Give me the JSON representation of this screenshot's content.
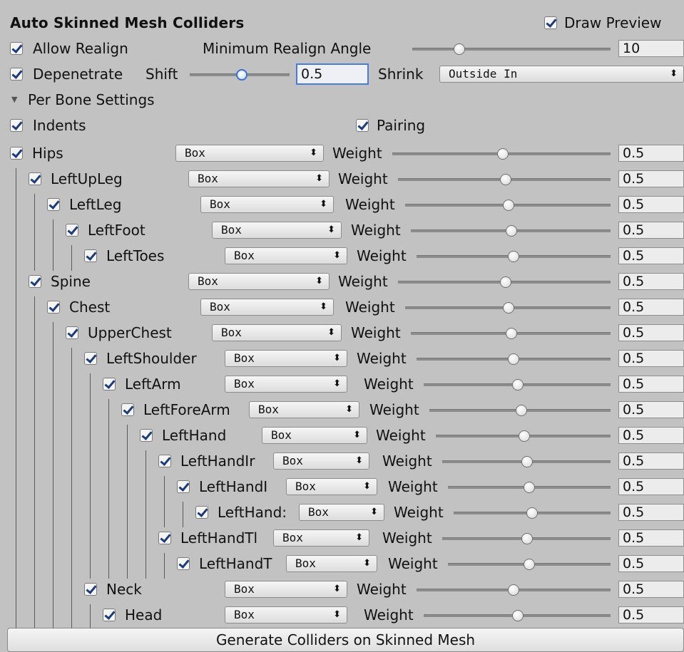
{
  "header": {
    "title": "Auto Skinned Mesh Colliders",
    "draw_preview_label": "Draw Preview",
    "draw_preview_checked": true
  },
  "realign": {
    "allow_label": "Allow Realign",
    "allow_checked": true,
    "min_angle_label": "Minimum Realign Angle",
    "min_angle_value": "10"
  },
  "depenetrate": {
    "label": "Depenetrate",
    "checked": true,
    "shift_label": "Shift",
    "shift_value": "0.5",
    "shrink_label": "Shrink",
    "shrink_value": "Outside In"
  },
  "per_bone": {
    "label": "Per Bone Settings"
  },
  "indents": {
    "label": "Indents",
    "checked": true
  },
  "pairing": {
    "label": "Pairing",
    "checked": true
  },
  "bones": [
    {
      "name": "Hips",
      "depth": 0,
      "shape": "Box",
      "weight_label": "Weight",
      "weight": "0.5"
    },
    {
      "name": "LeftUpLeg",
      "depth": 1,
      "shape": "Box",
      "weight_label": "Weight",
      "weight": "0.5"
    },
    {
      "name": "LeftLeg",
      "depth": 2,
      "shape": "Box",
      "weight_label": "Weight",
      "weight": "0.5"
    },
    {
      "name": "LeftFoot",
      "depth": 3,
      "shape": "Box",
      "weight_label": "Weight",
      "weight": "0.5"
    },
    {
      "name": "LeftToes",
      "depth": 4,
      "shape": "Box",
      "weight_label": "Weight",
      "weight": "0.5"
    },
    {
      "name": "Spine",
      "depth": 1,
      "shape": "Box",
      "weight_label": "Weight",
      "weight": "0.5"
    },
    {
      "name": "Chest",
      "depth": 2,
      "shape": "Box",
      "weight_label": "Weight",
      "weight": "0.5"
    },
    {
      "name": "UpperChest",
      "depth": 3,
      "shape": "Box",
      "weight_label": "Weight",
      "weight": "0.5"
    },
    {
      "name": "LeftShoulder",
      "depth": 4,
      "shape": "Box",
      "weight_label": "Weight",
      "weight": "0.5"
    },
    {
      "name": "LeftArm",
      "depth": 5,
      "shape": "Box",
      "weight_label": "Weight",
      "weight": "0.5"
    },
    {
      "name": "LeftForeArm",
      "depth": 6,
      "shape": "Box",
      "weight_label": "Weight",
      "weight": "0.5"
    },
    {
      "name": "LeftHand",
      "depth": 7,
      "shape": "Box",
      "weight_label": "Weight",
      "weight": "0.5"
    },
    {
      "name": "LeftHandIr",
      "depth": 8,
      "shape": "Box",
      "weight_label": "Weight",
      "weight": "0.5"
    },
    {
      "name": "LeftHandI",
      "depth": 9,
      "shape": "Box",
      "weight_label": "Weight",
      "weight": "0.5"
    },
    {
      "name": "LeftHand:",
      "depth": 10,
      "shape": "Box",
      "weight_label": "Weight",
      "weight": "0.5"
    },
    {
      "name": "LeftHandTl",
      "depth": 8,
      "shape": "Box",
      "weight_label": "Weight",
      "weight": "0.5"
    },
    {
      "name": "LeftHandT",
      "depth": 9,
      "shape": "Box",
      "weight_label": "Weight",
      "weight": "0.5"
    },
    {
      "name": "Neck",
      "depth": 4,
      "shape": "Box",
      "weight_label": "Weight",
      "weight": "0.5"
    },
    {
      "name": "Head",
      "depth": 5,
      "shape": "Box",
      "weight_label": "Weight",
      "weight": "0.5"
    }
  ],
  "generate_button": "Generate Colliders on Skinned Mesh"
}
